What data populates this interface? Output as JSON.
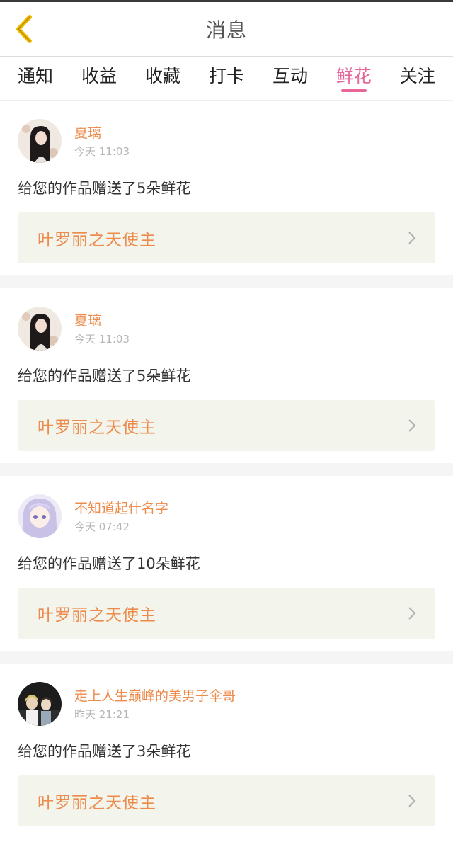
{
  "header": {
    "title": "消息",
    "back_icon": "chevron-left-icon",
    "accent_color": "#e8679b",
    "back_color": "#f0b800"
  },
  "tabs": [
    {
      "label": "通知",
      "active": false
    },
    {
      "label": "收益",
      "active": false
    },
    {
      "label": "收藏",
      "active": false
    },
    {
      "label": "打卡",
      "active": false
    },
    {
      "label": "互动",
      "active": false
    },
    {
      "label": "鲜花",
      "active": true
    },
    {
      "label": "关注",
      "active": false
    }
  ],
  "messages": [
    {
      "username": "夏璃",
      "time": "今天 11:03",
      "text": "给您的作品赠送了5朵鲜花",
      "work_title": "叶罗丽之天使主",
      "avatar_icon": "girl-dark-hair-avatar"
    },
    {
      "username": "夏璃",
      "time": "今天 11:03",
      "text": "给您的作品赠送了5朵鲜花",
      "work_title": "叶罗丽之天使主",
      "avatar_icon": "girl-dark-hair-avatar"
    },
    {
      "username": "不知道起什名字",
      "time": "今天 07:42",
      "text": "给您的作品赠送了10朵鲜花",
      "work_title": "叶罗丽之天使主",
      "avatar_icon": "girl-lilac-hair-avatar"
    },
    {
      "username": "走上人生巅峰的美男子伞哥",
      "time": "昨天 21:21",
      "text": "给您的作品赠送了3朵鲜花",
      "work_title": "叶罗丽之天使主",
      "avatar_icon": "boys-group-avatar"
    }
  ]
}
